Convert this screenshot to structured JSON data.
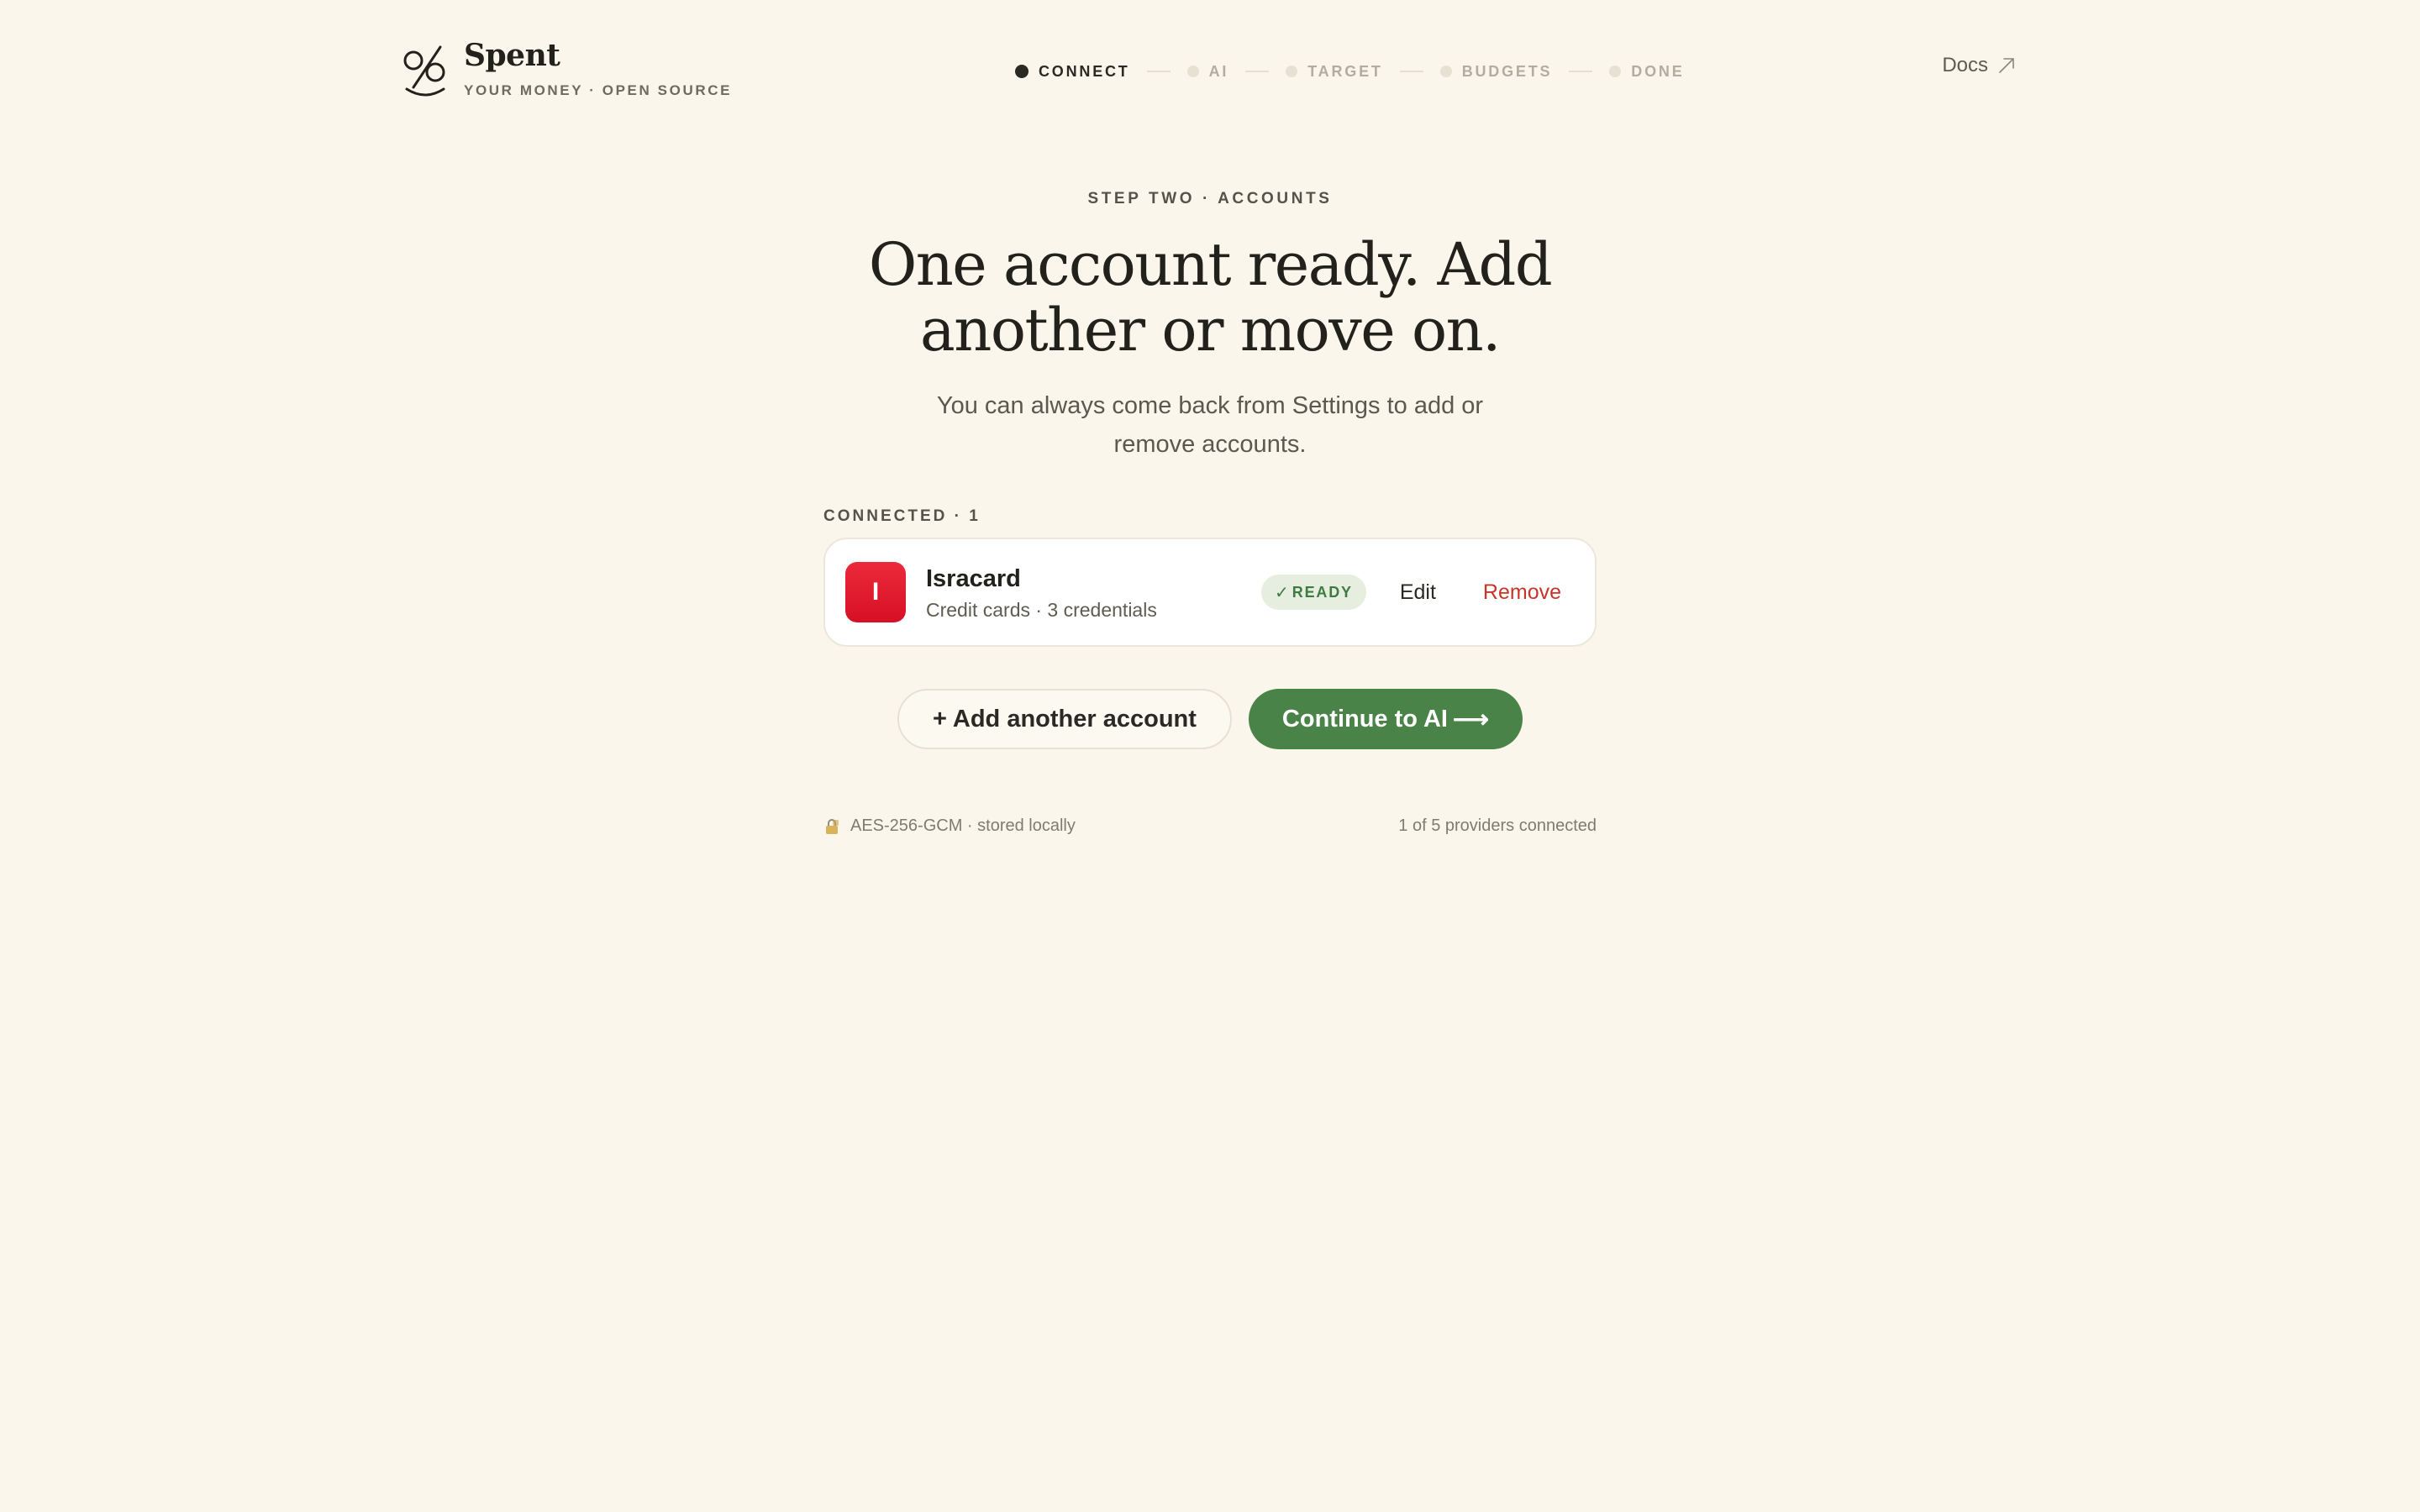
{
  "brand": {
    "name": "Spent",
    "tagline": "YOUR MONEY · OPEN SOURCE"
  },
  "steps": [
    {
      "label": "CONNECT",
      "active": true
    },
    {
      "label": "AI",
      "active": false
    },
    {
      "label": "TARGET",
      "active": false
    },
    {
      "label": "BUDGETS",
      "active": false
    },
    {
      "label": "DONE",
      "active": false
    }
  ],
  "header": {
    "docs_label": "Docs",
    "docs_icon": "external-arrow-icon"
  },
  "main": {
    "eyebrow": "STEP TWO · ACCOUNTS",
    "headline_line1": "One account ready. Add",
    "headline_line2": "another or move on.",
    "subhead": "You can always come back from Settings to add or remove accounts."
  },
  "connected": {
    "label": "CONNECTED · 1",
    "accounts": [
      {
        "initial": "I",
        "name": "Isracard",
        "meta": "Credit cards · 3 credentials",
        "status": "READY",
        "edit_label": "Edit",
        "remove_label": "Remove"
      }
    ]
  },
  "actions": {
    "add_label": "+ Add another account",
    "continue_label": "Continue to AI",
    "continue_arrow": "⟶"
  },
  "footer": {
    "security": "AES-256-GCM · stored locally",
    "providers": "1 of 5 providers connected"
  },
  "colors": {
    "background": "#faf6ec",
    "primary": "#4a8348",
    "danger": "#c7352a",
    "avatar": "#e01a30",
    "badge_bg": "#e6eee0",
    "badge_text": "#3f7a43"
  }
}
